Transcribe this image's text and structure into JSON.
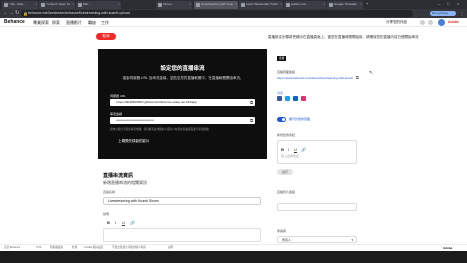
{
  "browser": {
    "tabs": [
      {
        "label": "Yuki - Raw..."
      },
      {
        "label": "Yu-Sen's Open Studio..."
      },
      {
        "label": "Mar..."
      },
      {
        "label": "Vimeo..."
      },
      {
        "label": "Livestreaming with Kuanti..."
      },
      {
        "label": "Learn Streamlabs Tutorial..."
      },
      {
        "label": "Adobe Live..."
      },
      {
        "label": "Google Translate"
      }
    ],
    "url": "behance.net/livestream/behance/livestreaming-with-kuanti-upload",
    "profile_label": "Not syncing"
  },
  "header": {
    "logo": "Behance",
    "nav": [
      "專業探索",
      "探索",
      "直播影片",
      "職缺",
      "工作"
    ],
    "right_text": "分享您的作品"
  },
  "top": {
    "cancel_label": "取消",
    "notice": "直播設定步驟將會顯示在直播頁面上，當您在直播時間開始後，請確保您的直播內容已經開始串流"
  },
  "stream_card": {
    "title": "設定您的直播串流",
    "description": "複製伺服器 URL 及串流金鑰，並貼至您的直播軟體中，在直播軟體開始串流。",
    "server_label": "伺服器 URL",
    "server_url": "rtmps://9b4b5f2b6f1f.global-contribute.live-video.net:443/app",
    "key_label": "串流金鑰",
    "key_value": "••••••••••••••••••••••••••••••••••••",
    "note": "請勿公開分享您的串流金鑰。任何擁有此金鑰的人都可以在您的直播頁面進行串流播放。",
    "link_label": "上傳預先錄製的影片"
  },
  "form": {
    "title": "直播串流資訊",
    "subtitle": "新增直播串流的相關資訊",
    "name_label": "直播名稱",
    "name_value": "Livestreaming with Kuanti Shuen",
    "desc_label": "說明",
    "toolbar": [
      "B",
      "I",
      "U",
      "🔗"
    ]
  },
  "sidebar": {
    "badge": "直播",
    "link_label": "直播頁面連結",
    "link_url": "https://www.behance.net/videos/livestreaming-with-kuanti",
    "share_label": "分享",
    "social_colors": [
      "#3b5998",
      "#1da1f2",
      "#0a66c2",
      "#e1306c"
    ],
    "toggle_label": "顯示於我的頁面",
    "toggle_on": true,
    "notes_label": "新增您的筆記",
    "notes_placeholder": "寫入您的筆記...",
    "notes_toolbar": [
      "B",
      "I",
      "U",
      "🔗"
    ],
    "save_label": "儲存",
    "section2_label": "直播影片連結",
    "section2_value": "",
    "section3_label": "參與者",
    "select_value": "所有人"
  },
  "bottom": {
    "left": "英文 Behance",
    "items": [
      "TOS",
      "隱私權政策",
      "社群",
      "Cookie 偏好設定",
      "不要出售或分享我的個人資訊",
      "說明",
      "Adobe"
    ]
  }
}
